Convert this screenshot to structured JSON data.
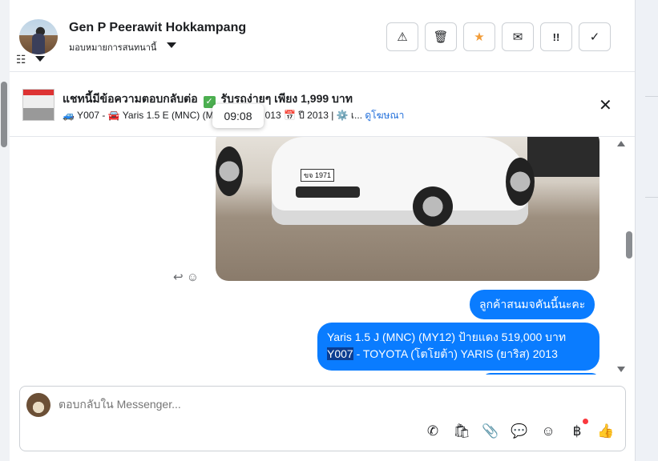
{
  "header": {
    "name": "Gen P Peerawit Hokkampang",
    "assign_label": "มอบหมายการสนทนานี้",
    "actions": [
      {
        "icon": "warning-icon",
        "glyph": "⚠"
      },
      {
        "icon": "trash-icon",
        "glyph": "🗑"
      },
      {
        "icon": "star-icon",
        "glyph": "★"
      },
      {
        "icon": "mail-icon",
        "glyph": "✉"
      },
      {
        "icon": "follow-up-icon",
        "glyph": "!!"
      },
      {
        "icon": "checkmark-icon",
        "glyph": "✓"
      }
    ]
  },
  "ad": {
    "title_before": "แชทนี้มีข้อความตอบกลับต่อ",
    "title_after": "รับรถง่ายๆ เพียง 1,999 บาท",
    "subtitle_a": "🚙 Y007 - 🚘 Yaris 1.5 E (MNC) (M",
    "subtitle_b": "013 📅 ปี 2013 | ⚙️ เ...",
    "link": "ดูโฆษณา"
  },
  "tooltip": "09:08",
  "photo": {
    "plate": "ขจ 1971"
  },
  "messages": {
    "m1": "ลูกค้าสนมจคันนี้นะคะ",
    "m2_line1": "Yaris 1.5 J (MNC) (MY12) ป้ายแดง 519,000 บาท",
    "m2_highlight": "Y007",
    "m2_line2_rest": " - TOYOTA (โตโยต้า) YARIS (ยาริส) 2013"
  },
  "composer": {
    "placeholder": "ตอบกลับใน Messenger...",
    "tools": [
      "call-add-icon",
      "shopping-bag-icon",
      "paperclip-icon",
      "chat-bubble-icon",
      "emoji-icon",
      "baht-icon",
      "thumbs-up-icon"
    ]
  },
  "colors": {
    "accent": "#0a7cff",
    "link": "#216fdb",
    "star": "#f29c38"
  }
}
